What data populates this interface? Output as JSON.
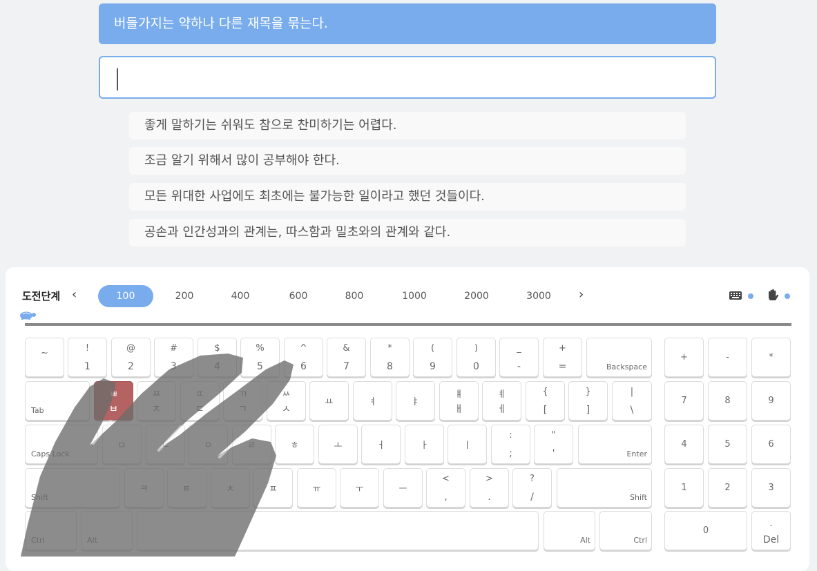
{
  "target_sentence": "버들가지는 약하나 다른 재목을 묶는다.",
  "input_value": "",
  "upcoming_sentences": [
    "좋게 말하기는 쉬워도 참으로 찬미하기는 어렵다.",
    "조금 알기 위해서 많이 공부해야 한다.",
    "모든 위대한 사업에도 최초에는 불가능한 일이라고 했던 것들이다.",
    "공손과 인간성과의 관계는, 따스함과 밀초와의 관계와 같다."
  ],
  "level_bar": {
    "title": "도전단계",
    "prev_arrow": "‹",
    "next_arrow": "›",
    "levels": [
      "100",
      "200",
      "400",
      "600",
      "800",
      "1000",
      "2000",
      "3000"
    ],
    "active_level": "100",
    "progress_fraction": 0
  },
  "icons": {
    "keyboard": "keyboard-icon",
    "hand": "hand-icon",
    "turtle": "turtle-icon"
  },
  "colors": {
    "accent": "#78acec",
    "highlight_key": "#b56362"
  },
  "highlighted_key": "ㅂ",
  "keyboard": {
    "row1": [
      {
        "top": "~",
        "bottom": ""
      },
      {
        "top": "!",
        "bottom": "1"
      },
      {
        "top": "@",
        "bottom": "2"
      },
      {
        "top": "#",
        "bottom": "3"
      },
      {
        "top": "$",
        "bottom": "4"
      },
      {
        "top": "%",
        "bottom": "5"
      },
      {
        "top": "^",
        "bottom": "6"
      },
      {
        "top": "&",
        "bottom": "7"
      },
      {
        "top": "*",
        "bottom": "8"
      },
      {
        "top": "(",
        "bottom": "9"
      },
      {
        "top": ")",
        "bottom": "0"
      },
      {
        "top": "_",
        "bottom": "-"
      },
      {
        "top": "+",
        "bottom": "="
      }
    ],
    "backspace": "Backspace",
    "tab": "Tab",
    "row2": [
      {
        "top": "ㅃ",
        "bottom": "ㅂ"
      },
      {
        "top": "ㅉ",
        "bottom": "ㅈ"
      },
      {
        "top": "ㄸ",
        "bottom": "ㄷ"
      },
      {
        "top": "ㄲ",
        "bottom": "ㄱ"
      },
      {
        "top": "ㅆ",
        "bottom": "ㅅ"
      },
      {
        "top": "",
        "bottom": "ㅛ"
      },
      {
        "top": "",
        "bottom": "ㅕ"
      },
      {
        "top": "",
        "bottom": "ㅑ"
      },
      {
        "top": "ㅒ",
        "bottom": "ㅐ"
      },
      {
        "top": "ㅖ",
        "bottom": "ㅔ"
      },
      {
        "top": "{",
        "bottom": "["
      },
      {
        "top": "}",
        "bottom": "]"
      },
      {
        "top": "|",
        "bottom": "\\"
      }
    ],
    "capslock": "Caps Lock",
    "row3": [
      {
        "top": "",
        "bottom": "ㅁ"
      },
      {
        "top": "",
        "bottom": "ㄴ"
      },
      {
        "top": "",
        "bottom": "ㅇ"
      },
      {
        "top": "",
        "bottom": "ㄹ"
      },
      {
        "top": "",
        "bottom": "ㅎ"
      },
      {
        "top": "",
        "bottom": "ㅗ"
      },
      {
        "top": "",
        "bottom": "ㅓ"
      },
      {
        "top": "",
        "bottom": "ㅏ"
      },
      {
        "top": "",
        "bottom": "ㅣ"
      },
      {
        "top": ":",
        "bottom": ";"
      },
      {
        "top": "\"",
        "bottom": "'"
      }
    ],
    "enter": "Enter",
    "shift_left": "Shift",
    "row4": [
      {
        "top": "",
        "bottom": "ㅋ"
      },
      {
        "top": "",
        "bottom": "ㅌ"
      },
      {
        "top": "",
        "bottom": "ㅊ"
      },
      {
        "top": "",
        "bottom": "ㅍ"
      },
      {
        "top": "",
        "bottom": "ㅠ"
      },
      {
        "top": "",
        "bottom": "ㅜ"
      },
      {
        "top": "",
        "bottom": "ㅡ"
      },
      {
        "top": "<",
        "bottom": ","
      },
      {
        "top": ">",
        "bottom": "."
      },
      {
        "top": "?",
        "bottom": "/"
      }
    ],
    "shift_right": "Shift",
    "ctrl_left": "Ctrl",
    "alt_left": "Alt",
    "alt_right": "Alt",
    "ctrl_right": "Ctrl",
    "numpad": {
      "row1": [
        "+",
        "-",
        "*"
      ],
      "row2": [
        "7",
        "8",
        "9"
      ],
      "row3": [
        "4",
        "5",
        "6"
      ],
      "row4": [
        "1",
        "2",
        "3"
      ],
      "zero": "0",
      "del_top": ".",
      "del_bottom": "Del"
    }
  }
}
